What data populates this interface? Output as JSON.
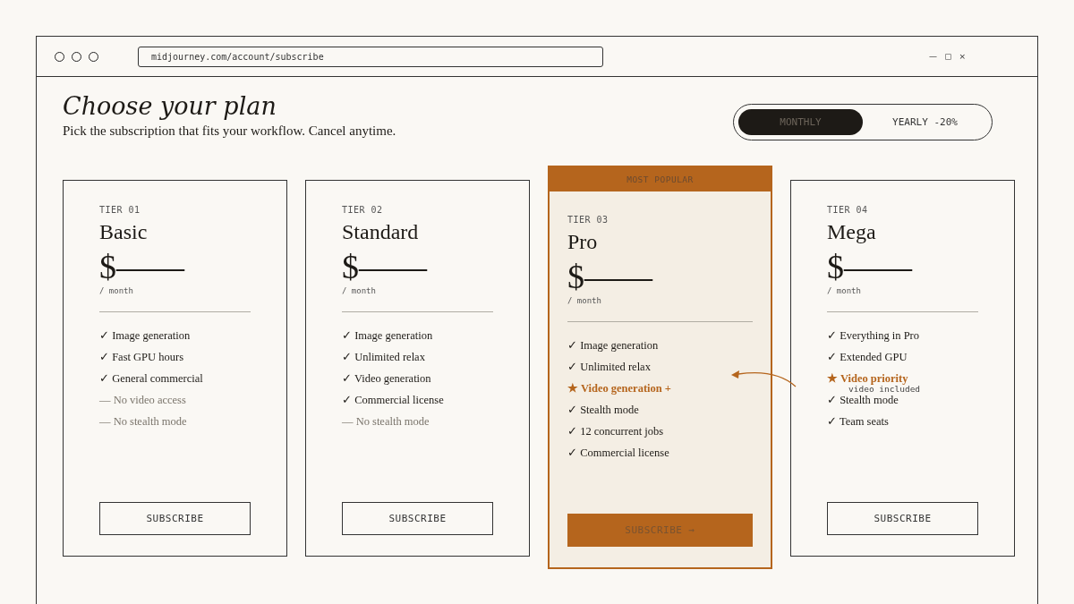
{
  "browser": {
    "url": "midjourney.com/account/subscribe",
    "window_controls": [
      "—",
      "▢",
      "×"
    ]
  },
  "header": {
    "title": "Choose your plan",
    "subtitle": "Pick the subscription that fits your workflow. Cancel anytime."
  },
  "billing_toggle": [
    {
      "label": "MONTHLY",
      "selected": true
    },
    {
      "label": "YEARLY -20%",
      "selected": false
    }
  ],
  "plans": [
    {
      "tier": "TIER 01",
      "name": "Basic",
      "price": "$——",
      "period": "/ month",
      "popular": false,
      "button": "SUBSCRIBE",
      "features": [
        {
          "kind": "check",
          "icon": "✓",
          "text": "Image generation"
        },
        {
          "kind": "check",
          "icon": "✓",
          "text": "Fast GPU hours"
        },
        {
          "kind": "check",
          "icon": "✓",
          "text": "General commercial"
        },
        {
          "kind": "missing",
          "icon": "—",
          "text": "No video access"
        },
        {
          "kind": "missing",
          "icon": "—",
          "text": "No stealth mode"
        }
      ]
    },
    {
      "tier": "TIER 02",
      "name": "Standard",
      "price": "$——",
      "period": "/ month",
      "popular": false,
      "button": "SUBSCRIBE",
      "features": [
        {
          "kind": "check",
          "icon": "✓",
          "text": "Image generation"
        },
        {
          "kind": "check",
          "icon": "✓",
          "text": "Unlimited relax"
        },
        {
          "kind": "check",
          "icon": "✓",
          "text": "Video generation"
        },
        {
          "kind": "check",
          "icon": "✓",
          "text": "Commercial license"
        },
        {
          "kind": "missing",
          "icon": "—",
          "text": "No stealth mode"
        }
      ]
    },
    {
      "tier": "TIER 03",
      "name": "Pro",
      "price": "$——",
      "period": "/ month",
      "popular": true,
      "badge": "MOST POPULAR",
      "button": "SUBSCRIBE →",
      "features": [
        {
          "kind": "check",
          "icon": "✓",
          "text": "Image generation"
        },
        {
          "kind": "check",
          "icon": "✓",
          "text": "Unlimited relax"
        },
        {
          "kind": "star",
          "icon": "★",
          "text": "Video generation +"
        },
        {
          "kind": "check",
          "icon": "✓",
          "text": "Stealth mode"
        },
        {
          "kind": "check",
          "icon": "✓",
          "text": "12 concurrent jobs"
        },
        {
          "kind": "check",
          "icon": "✓",
          "text": "Commercial license"
        }
      ]
    },
    {
      "tier": "TIER 04",
      "name": "Mega",
      "price": "$——",
      "period": "/ month",
      "popular": false,
      "button": "SUBSCRIBE",
      "features": [
        {
          "kind": "check",
          "icon": "✓",
          "text": "Everything in Pro"
        },
        {
          "kind": "check",
          "icon": "✓",
          "text": "Extended GPU"
        },
        {
          "kind": "star",
          "icon": "★",
          "text": "Video priority",
          "note": "video included"
        },
        {
          "kind": "check",
          "icon": "✓",
          "text": "Stealth mode"
        },
        {
          "kind": "check",
          "icon": "✓",
          "text": "Team seats"
        }
      ]
    }
  ]
}
